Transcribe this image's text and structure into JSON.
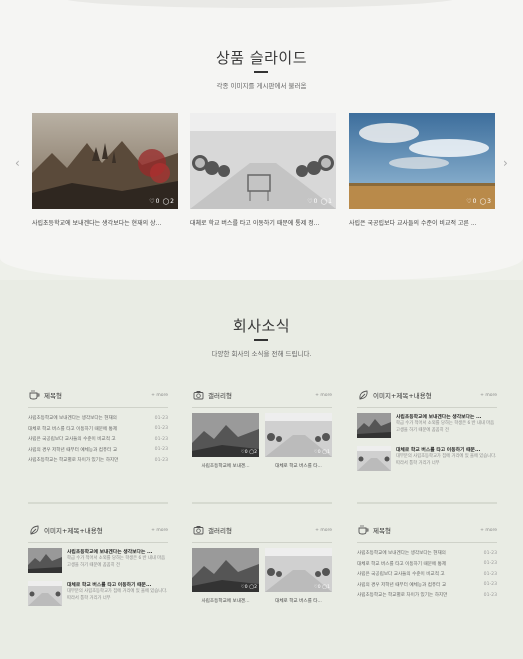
{
  "slider": {
    "title": "상품 슬라이드",
    "subtitle": "각종 이미지를 게시판에서 불러옴",
    "prev_icon": "chevron-left",
    "next_icon": "chevron-right",
    "items": [
      {
        "caption": "사립초등학교에 보내겐다는 생각보다는 현재의 상...",
        "likes": "0",
        "comments": "2"
      },
      {
        "caption": "대체로 학교 버스를 타고 이동하기 때문에 통제 정...",
        "likes": "0",
        "comments": "1"
      },
      {
        "caption": "사립은 국공립보다 교사들의 수준이 비교적 고른 ...",
        "likes": "0",
        "comments": "3"
      }
    ]
  },
  "news": {
    "title": "회사소식",
    "subtitle": "다양한 회사의 소식을 전해 드립니다."
  },
  "panels": {
    "p1": {
      "title": "제목형",
      "more": "+ more",
      "icon": "coffee-icon"
    },
    "p2": {
      "title": "갤러리형",
      "more": "+ more",
      "icon": "camera-icon"
    },
    "p3": {
      "title": "이미지+제목+내용형",
      "more": "+ more",
      "icon": "leaf-icon"
    },
    "p4": {
      "title": "이미지+제목+내용형",
      "more": "+ more",
      "icon": "leaf-icon"
    },
    "p5": {
      "title": "갤러리형",
      "more": "+ more",
      "icon": "camera-icon"
    },
    "p6": {
      "title": "제목형",
      "more": "+ more",
      "icon": "coffee-icon"
    }
  },
  "list_items": [
    {
      "text": "사립초등학교에 보내겐다는 생각보다는 현재의",
      "date": "01-23"
    },
    {
      "text": "대체로 학교 버스를 타고 이동하기 때문에 통제",
      "date": "01-23"
    },
    {
      "text": "사립은 국공립보다 교사들의 수준이 비교적 고",
      "date": "01-23"
    },
    {
      "text": "사립의 경우 저학년 때부터 예체능과 컴퓨터 교",
      "date": "01-23"
    },
    {
      "text": "사립초등학교는 학교별로 차이가 있기는 하지만",
      "date": "01-23"
    }
  ],
  "gallery_items": [
    {
      "caption": "사립초등학교에 보내겐...",
      "likes": "0",
      "comments": "2"
    },
    {
      "caption": "대체로 학교 버스를 타...",
      "likes": "0",
      "comments": "1"
    }
  ],
  "text_items": [
    {
      "title": "사립초등학교에 보내겐다는 생각보다는 ...",
      "body": "학급 수가 적어서 소외를 당하는 학생은 6 반 내내 마음고생을 하기 때문에 꼼꼼히 전"
    },
    {
      "title": "대체로 학교 버스를 타고 이동하기 때문...",
      "body": "대부분의 사립초등학교가 집에 거리에 있 을에 있습니다. 따라서 통학 거리가 너무"
    }
  ],
  "colors": {
    "page_bg": "#eef0ea",
    "top_bg": "#f5f5f3",
    "accent": "#333333"
  }
}
